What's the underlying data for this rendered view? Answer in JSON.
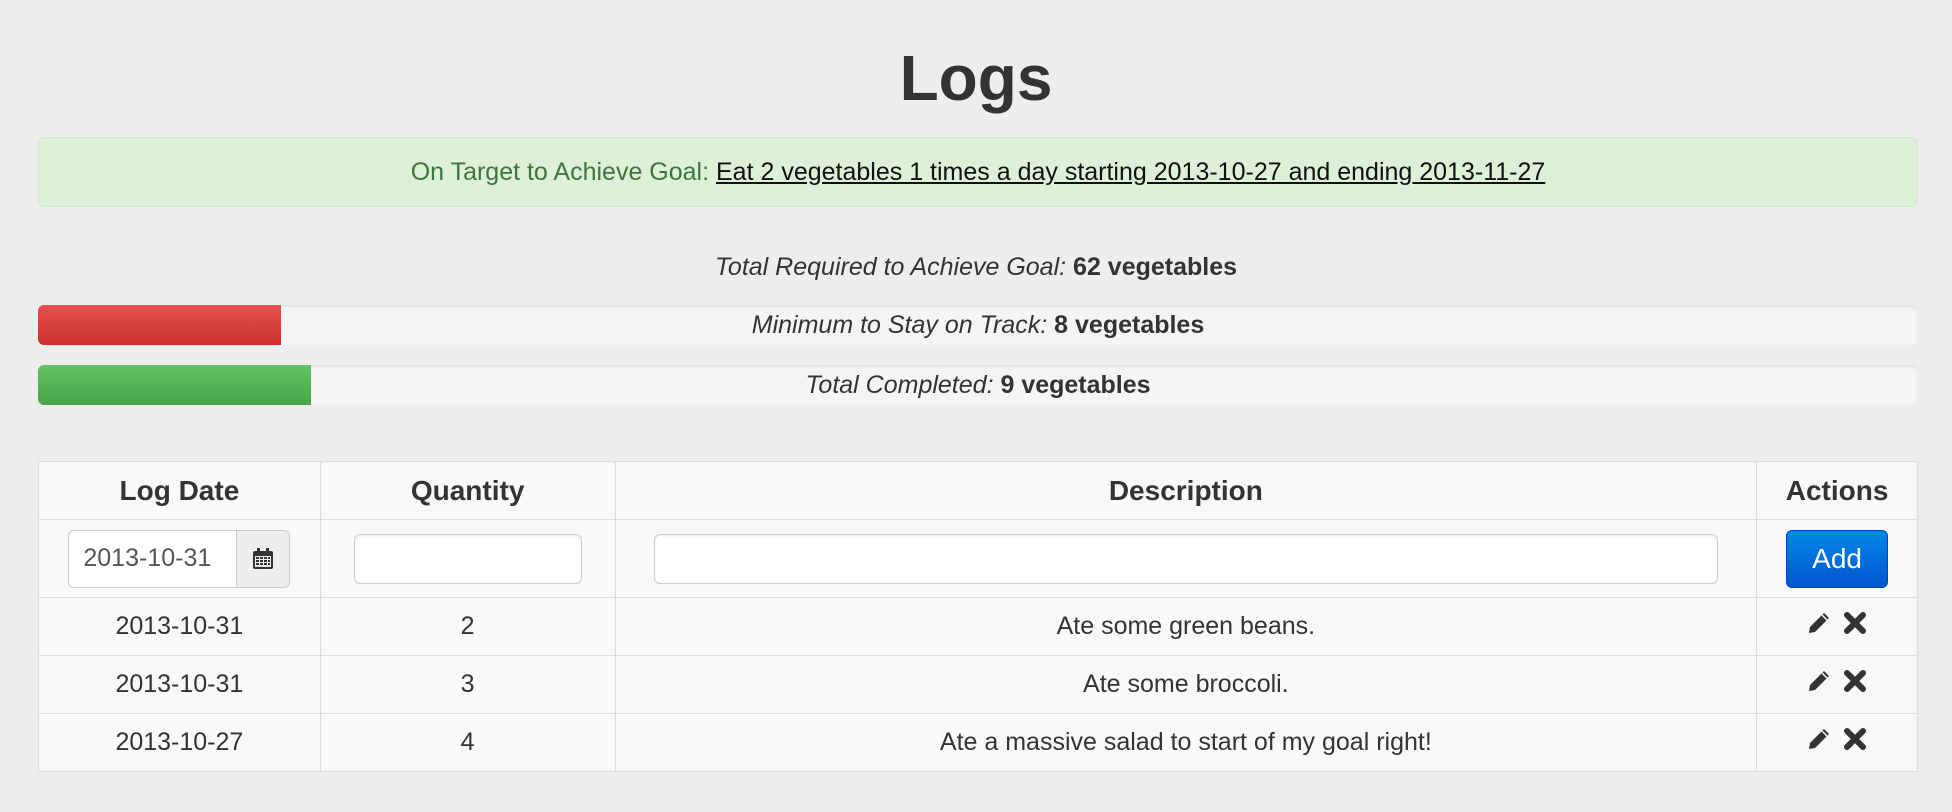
{
  "page": {
    "title": "Logs"
  },
  "alert": {
    "status_label": "On Target to Achieve Goal:",
    "goal_link": "Eat 2 vegetables 1 times a day starting 2013-10-27 and ending 2013-11-27",
    "color": "#3c763d"
  },
  "summary": {
    "total_required_label": "Total Required to Achieve Goal:",
    "total_required_value": "62 vegetables"
  },
  "bars": {
    "minimum": {
      "label": "Minimum to Stay on Track:",
      "value": "8 vegetables",
      "progress_fraction": 0.129,
      "color": "#d9534f"
    },
    "completed": {
      "label": "Total Completed:",
      "value": "9 vegetables",
      "progress_fraction": 0.145,
      "color": "#5cb85c"
    }
  },
  "table": {
    "headers": {
      "log_date": "Log Date",
      "quantity": "Quantity",
      "description": "Description",
      "actions": "Actions"
    },
    "input_row": {
      "date_value": "2013-10-31",
      "date_icon": "calendar-icon",
      "quantity_value": "",
      "description_value": "",
      "add_label": "Add"
    },
    "rows": [
      {
        "date": "2013-10-31",
        "quantity": "2",
        "description": "Ate some green beans."
      },
      {
        "date": "2013-10-31",
        "quantity": "3",
        "description": "Ate some broccoli."
      },
      {
        "date": "2013-10-27",
        "quantity": "4",
        "description": "Ate a massive salad to start of my goal right!"
      }
    ],
    "action_icons": [
      "pencil-icon",
      "close-icon"
    ]
  }
}
